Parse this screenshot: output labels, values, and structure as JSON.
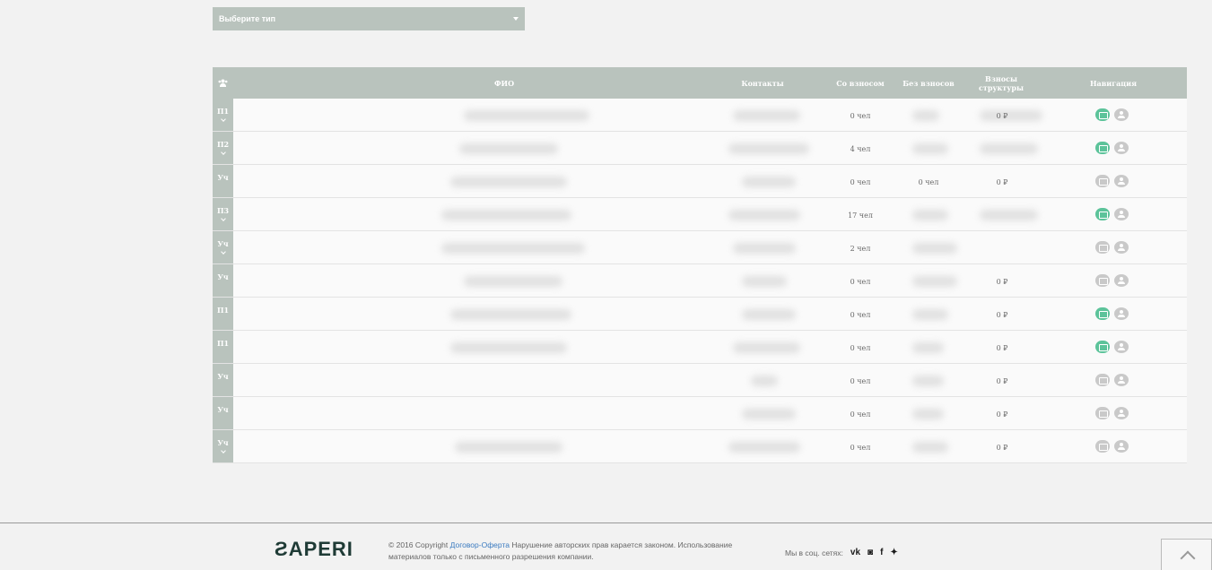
{
  "filter": {
    "type_select": "Выберите тип"
  },
  "table": {
    "headers": {
      "fio": "ФИО",
      "contacts": "Контакты",
      "with_fee": "Со взносом",
      "without_fee": "Без взносов",
      "structure_fees": "Взносы структуры",
      "navigation": "Навигация"
    },
    "rows": [
      {
        "badge": "П1",
        "chevron": true,
        "with_fee": "0 чел",
        "without_fee": "",
        "structure_fees": "0 ₽",
        "money_active": true
      },
      {
        "badge": "П2",
        "chevron": true,
        "with_fee": "4 чел",
        "without_fee": "",
        "structure_fees": "",
        "money_active": true
      },
      {
        "badge": "Уч",
        "chevron": false,
        "with_fee": "0 чел",
        "without_fee": "0 чел",
        "structure_fees": "0 ₽",
        "money_active": false
      },
      {
        "badge": "П3",
        "chevron": true,
        "with_fee": "17 чел",
        "without_fee": "",
        "structure_fees": "",
        "money_active": true
      },
      {
        "badge": "Уч",
        "chevron": true,
        "with_fee": "2 чел",
        "without_fee": "",
        "structure_fees": "",
        "money_active": false
      },
      {
        "badge": "Уч",
        "chevron": false,
        "with_fee": "0 чел",
        "without_fee": "",
        "structure_fees": "0 ₽",
        "money_active": false
      },
      {
        "badge": "П1",
        "chevron": false,
        "with_fee": "0 чел",
        "without_fee": "",
        "structure_fees": "0 ₽",
        "money_active": true
      },
      {
        "badge": "П1",
        "chevron": false,
        "with_fee": "0 чел",
        "without_fee": "",
        "structure_fees": "0 ₽",
        "money_active": true
      },
      {
        "badge": "Уч",
        "chevron": false,
        "with_fee": "0 чел",
        "without_fee": "",
        "structure_fees": "0 ₽",
        "money_active": false
      },
      {
        "badge": "Уч",
        "chevron": false,
        "with_fee": "0 чел",
        "without_fee": "",
        "structure_fees": "0 ₽",
        "money_active": false
      },
      {
        "badge": "Уч",
        "chevron": true,
        "with_fee": "0 чел",
        "without_fee": "",
        "structure_fees": "0 ₽",
        "money_active": false
      }
    ]
  },
  "footer": {
    "logo": "APERI",
    "copyright_prefix": "© 2016 Copyright",
    "offer_link": "Договор-Оферта",
    "copyright_text": "Нарушение авторских прав карается законом. Использование материалов только с письменного разрешения компании.",
    "social_label": "Мы в соц. сетях:",
    "social": [
      "vk",
      "instagram",
      "facebook",
      "twitter"
    ]
  },
  "icons": {
    "users": "users-icon",
    "money": "money-icon",
    "profile": "user-icon",
    "scroll_top": "chevron-up-icon"
  },
  "colors": {
    "header_bg": "#b9c3bd",
    "active_icon": "#5cc39a",
    "inactive_icon": "#c9c9c9",
    "link": "#3b7bc0"
  }
}
